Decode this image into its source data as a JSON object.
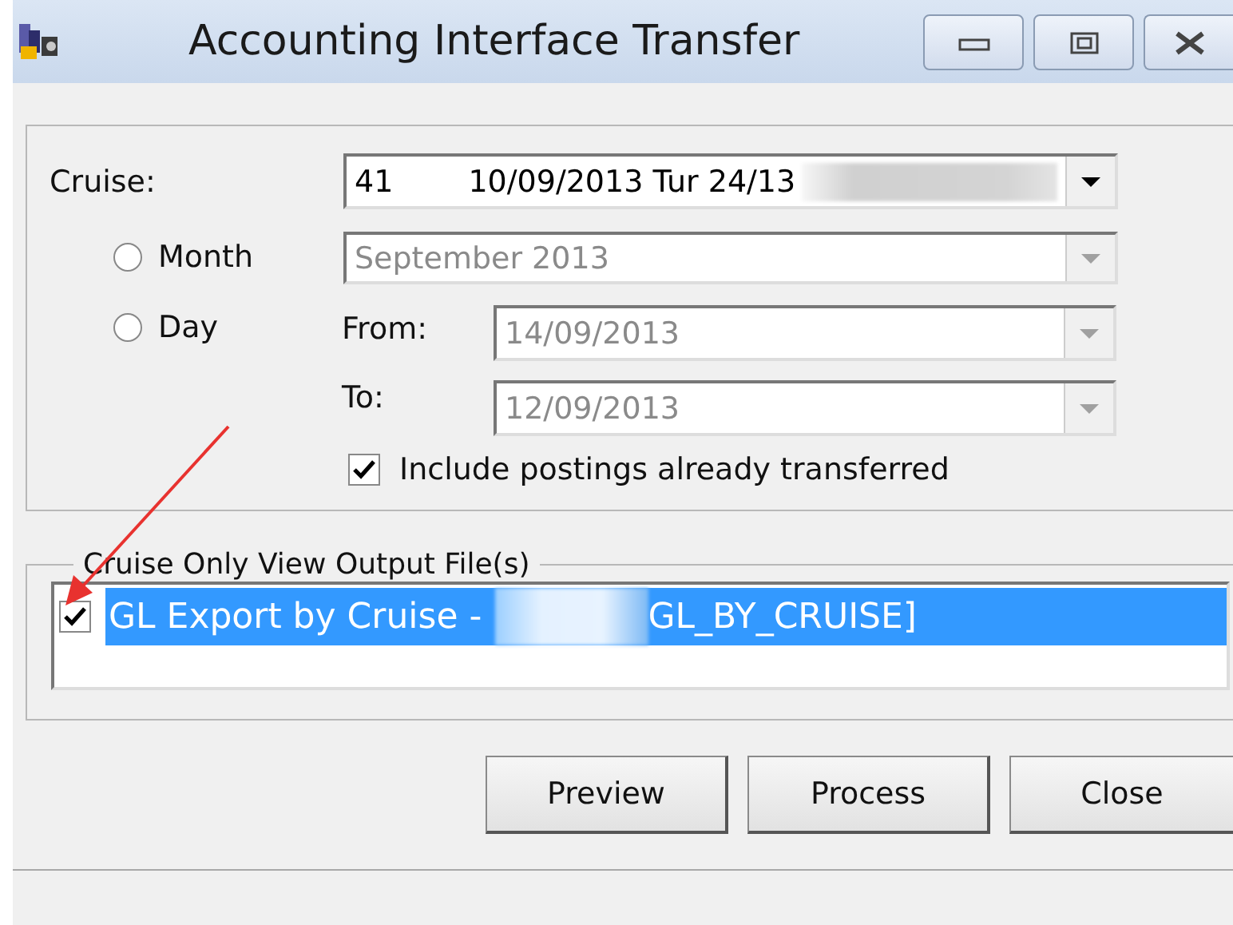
{
  "window": {
    "title": "Accounting Interface Transfer"
  },
  "cruise": {
    "label": "Cruise:",
    "number": "41",
    "value": "10/09/2013 Tur 24/13"
  },
  "period_options": [
    {
      "label": "Month",
      "selected": false
    },
    {
      "label": "Day",
      "selected": false
    }
  ],
  "month": {
    "value": "September 2013",
    "disabled": true
  },
  "from": {
    "label": "From:",
    "value": "14/09/2013",
    "disabled": true
  },
  "to": {
    "label": "To:",
    "value": "12/09/2013",
    "disabled": true
  },
  "include_transferred": {
    "label": "Include postings already transferred",
    "checked": true
  },
  "output_files": {
    "title": "Cruise Only View Output File(s)",
    "items": [
      {
        "prefix": "GL Export by Cruise -",
        "suffix": "GL_BY_CRUISE]",
        "checked": true,
        "selected": true
      }
    ]
  },
  "buttons": [
    "Preview",
    "Process",
    "Close"
  ]
}
